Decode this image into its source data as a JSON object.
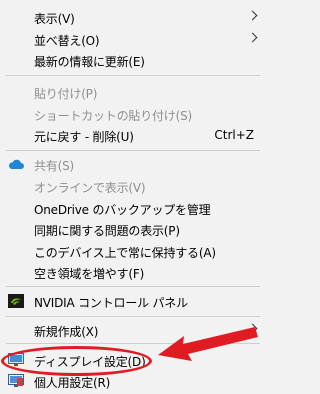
{
  "menu": {
    "view": {
      "label": "表示(V)"
    },
    "sort_by": {
      "label": "並べ替え(O)"
    },
    "refresh": {
      "label": "最新の情報に更新(E)"
    },
    "paste": {
      "label": "貼り付け(P)"
    },
    "paste_shortcut": {
      "label": "ショートカットの貼り付け(S)"
    },
    "undo_delete": {
      "label": "元に戻す - 削除(U)",
      "shortcut": "Ctrl+Z"
    },
    "share": {
      "label": "共有(S)"
    },
    "view_online": {
      "label": "オンラインで表示(V)"
    },
    "onedrive_backup": {
      "label": "OneDrive のバックアップを管理"
    },
    "sync_issues": {
      "label": "同期に関する問題の表示(P)"
    },
    "keep_on_device": {
      "label": "このデバイス上で常に保持する(A)"
    },
    "free_up_space": {
      "label": "空き領域を増やす(F)"
    },
    "nvidia_panel": {
      "label": "NVIDIA コントロール パネル"
    },
    "new": {
      "label": "新規作成(X)"
    },
    "display_settings": {
      "label": "ディスプレイ設定(D)"
    },
    "personalize": {
      "label": "個人用設定(R)"
    }
  },
  "annotation": {
    "color": "#e01b22"
  }
}
